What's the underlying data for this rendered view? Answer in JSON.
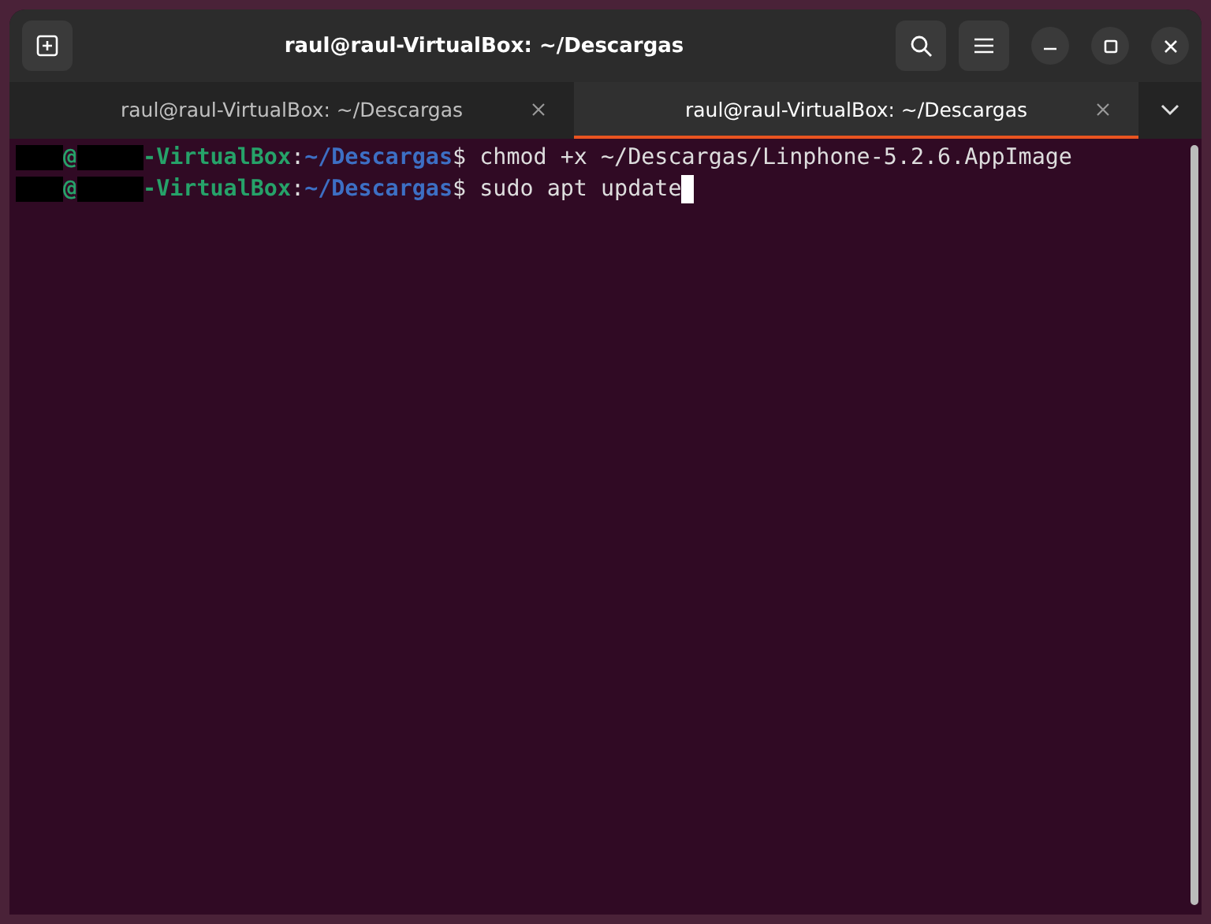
{
  "window": {
    "title": "raul@raul-VirtualBox: ~/Descargas"
  },
  "tabs": [
    {
      "label": "raul@raul-VirtualBox: ~/Descargas",
      "selected": false
    },
    {
      "label": "raul@raul-VirtualBox: ~/Descargas",
      "selected": true
    }
  ],
  "terminal": {
    "lines": [
      {
        "at": "@",
        "host": "-VirtualBox",
        "colon": ":",
        "path": "~/Descargas",
        "dollar": "$",
        "command": "chmod +x ~/Descargas/Linphone-5.2.6.AppImage",
        "cursor": false
      },
      {
        "at": "@",
        "host": "-VirtualBox",
        "colon": ":",
        "path": "~/Descargas",
        "dollar": "$",
        "command": "sudo apt update",
        "cursor": true
      }
    ]
  }
}
